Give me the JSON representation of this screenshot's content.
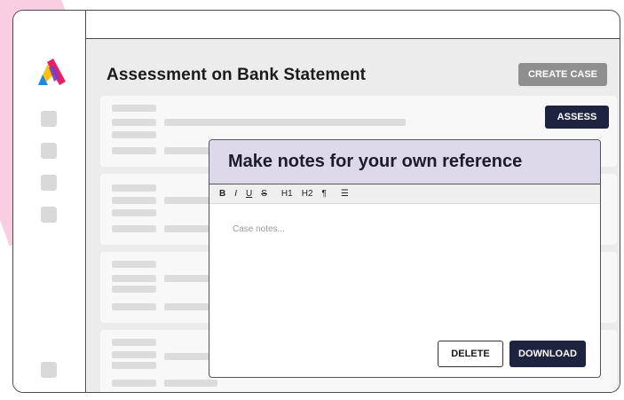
{
  "app": {
    "title": "Assessment on Bank Statement",
    "create_case_label": "CREATE CASE",
    "assess_label": "ASSESS"
  },
  "sidebar": {
    "logo": "app-logo",
    "items": [
      "nav-item-1",
      "nav-item-2",
      "nav-item-3",
      "nav-item-4",
      "nav-item-bottom"
    ]
  },
  "notes_panel": {
    "heading": "Make notes for your own reference",
    "toolbar": {
      "bold": "B",
      "italic": "I",
      "underline": "U",
      "strikethrough": "S",
      "h1": "H1",
      "h2": "H2",
      "paragraph": "¶",
      "list": "☰"
    },
    "placeholder": "Case notes...",
    "delete_label": "DELETE",
    "download_label": "DOWNLOAD"
  },
  "colors": {
    "accent_dark": "#1e2340",
    "notes_header": "#ddd9ea",
    "pink_blob": "#f7c9dd",
    "disabled_button": "#8f8f8f"
  }
}
